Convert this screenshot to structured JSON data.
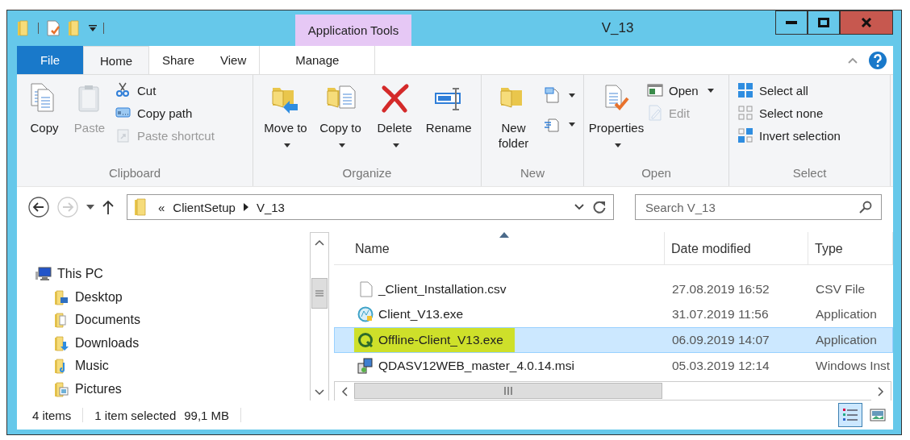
{
  "window": {
    "title": "V_13",
    "contextual_tab_group": "Application Tools"
  },
  "ribbon_tabs": [
    {
      "label": "File",
      "kind": "file",
      "selected": false
    },
    {
      "label": "Home",
      "kind": "tab",
      "selected": true
    },
    {
      "label": "Share",
      "kind": "tab",
      "selected": false
    },
    {
      "label": "View",
      "kind": "tab",
      "selected": false
    },
    {
      "label": "Manage",
      "kind": "contextual",
      "selected": false
    }
  ],
  "ribbon_groups": [
    {
      "label": "Clipboard",
      "items": [
        {
          "kind": "large",
          "label": "Copy",
          "disabled": false,
          "dropdown": false
        },
        {
          "kind": "large",
          "label": "Paste",
          "disabled": true,
          "dropdown": false
        },
        {
          "kind": "small",
          "label": "Cut",
          "disabled": false,
          "dropdown": false
        },
        {
          "kind": "small",
          "label": "Copy path",
          "disabled": false,
          "dropdown": false
        },
        {
          "kind": "small",
          "label": "Paste shortcut",
          "disabled": true,
          "dropdown": false
        }
      ]
    },
    {
      "label": "Organize",
      "items": [
        {
          "kind": "large",
          "label": "Move to",
          "disabled": false,
          "dropdown": true
        },
        {
          "kind": "large",
          "label": "Copy to",
          "disabled": false,
          "dropdown": true
        },
        {
          "kind": "large",
          "label": "Delete",
          "disabled": false,
          "dropdown": true
        },
        {
          "kind": "large",
          "label": "Rename",
          "disabled": false,
          "dropdown": false
        }
      ]
    },
    {
      "label": "New",
      "items": [
        {
          "kind": "large",
          "label": "New folder",
          "disabled": false,
          "dropdown": false
        },
        {
          "kind": "icon",
          "disabled": false,
          "dropdown": true
        },
        {
          "kind": "icon",
          "disabled": false,
          "dropdown": true
        }
      ]
    },
    {
      "label": "Open",
      "items": [
        {
          "kind": "large",
          "label": "Properties",
          "disabled": false,
          "dropdown": true
        },
        {
          "kind": "small",
          "label": "Open",
          "disabled": false,
          "dropdown": true
        },
        {
          "kind": "small",
          "label": "Edit",
          "disabled": true,
          "dropdown": false
        }
      ]
    },
    {
      "label": "Select",
      "items": [
        {
          "kind": "small",
          "label": "Select all",
          "disabled": false,
          "dropdown": false
        },
        {
          "kind": "small",
          "label": "Select none",
          "disabled": false,
          "dropdown": false
        },
        {
          "kind": "small",
          "label": "Invert selection",
          "disabled": false,
          "dropdown": false
        }
      ]
    }
  ],
  "address_bar": {
    "overflow": "«",
    "crumbs": [
      "ClientSetup",
      "V_13"
    ]
  },
  "search": {
    "placeholder": "Search V_13"
  },
  "navigation": [
    {
      "label": "This PC",
      "children": [
        {
          "label": "Desktop"
        },
        {
          "label": "Documents"
        },
        {
          "label": "Downloads"
        },
        {
          "label": "Music"
        },
        {
          "label": "Pictures"
        }
      ]
    }
  ],
  "table": {
    "columns": [
      "Name",
      "Date modified",
      "Type"
    ],
    "rows": [
      {
        "name": "_Client_Installation.csv",
        "date": "27.08.2019 16:52",
        "type": "CSV File",
        "selected": false,
        "highlighted": false
      },
      {
        "name": "Client_V13.exe",
        "date": "31.07.2019 11:56",
        "type": "Application",
        "selected": false,
        "highlighted": false
      },
      {
        "name": "Offline-Client_V13.exe",
        "date": "06.09.2019 14:07",
        "type": "Application",
        "selected": true,
        "highlighted": true
      },
      {
        "name": "QDASV12WEB_master_4.0.14.msi",
        "date": "05.03.2019 12:14",
        "type": "Windows Inst",
        "selected": false,
        "highlighted": false
      }
    ]
  },
  "status_bar": {
    "item_count": "4 items",
    "selection": "1 item selected",
    "size": "99,1 MB"
  },
  "view_buttons": [
    {
      "selected": true
    },
    {
      "selected": false
    }
  ]
}
